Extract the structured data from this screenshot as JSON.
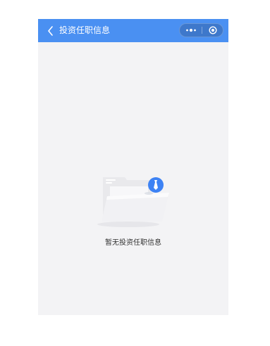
{
  "navbar": {
    "title": "投资任职信息",
    "background_color": "#4a90f2",
    "back_icon": "chevron-left-icon",
    "more_icon": "more-dots-icon",
    "close_icon": "target-close-icon"
  },
  "empty_state": {
    "illustration": "empty-folder-with-tie-icon",
    "message": "暂无投资任职信息",
    "accent_color": "#3d82f4"
  },
  "page": {
    "background_color": "#f3f3f5"
  }
}
